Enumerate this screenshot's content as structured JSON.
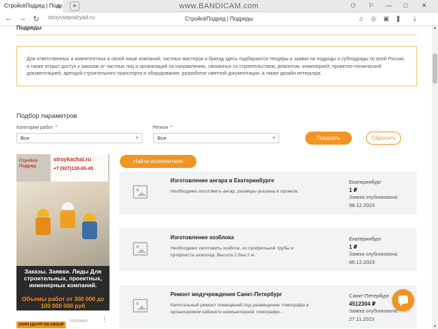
{
  "browser": {
    "tab_title": "СтройсёПодряд | Подр",
    "tab_close": "×",
    "new_tab": "+",
    "watermark": "www.BANDICAM.com",
    "url": "stroyvsepodryad.ru",
    "page_title": "СтройсёПодряд | Подряды"
  },
  "page": {
    "breadcrumb": "Подряды",
    "info_text": "Для ответственных и компетентных в своей нише компаний, частных мастеров и бригад здесь подбираются тендеры и заявки на подряды и субподряды по всей России, а также открыт доступ к заказам от частных лиц и организаций по направлению, связанных со строительством, ремонтом, инженерией, проектно-технической документацией, арендой строительного транспорта и оборудования, разработке сметной документации, а также дизайн интерьера."
  },
  "filters": {
    "title": "Подбор параметров",
    "category_label": "Категории работ",
    "category_value": "Все",
    "region_label": "Регион",
    "region_value": "Все",
    "show_button": "Показать",
    "reset_button": "Сбросить"
  },
  "ad": {
    "logo_text": "Стройсё Подряд",
    "site": "stroykachat.ru",
    "phone": "+7 (927)130-65-45",
    "slogan": "Заказы. Заявки. Лиды Для строительных, проектных, инженерных компаний.",
    "slogan2": "Объемы работ от 300 000 до 100 000 000 руб",
    "footer_tag": "ХОЛЛ ЦЕНТР DS GROUP",
    "footer_label": "РЕКЛАМА",
    "footer_dots": "⋮"
  },
  "find_button": "Найти исполнителя",
  "listings": [
    {
      "title": "Изготовление ангара в Екатеринбурге",
      "desc": "Необходимо изготовить ангар, размеры указаны в проекте.",
      "city": "Екатеринбург",
      "price": "1 ₽",
      "published_label": "Заявка опубликована:",
      "date": "08.12.2023"
    },
    {
      "title": "Изготовление хозблока",
      "desc": "Необходимо изготовить хозблок, из профильной трубы и профлиста шоколад. Высота 2.5на 2 м.",
      "city": "Екатеринбург",
      "price": "1 ₽",
      "published_label": "Заявка опубликована:",
      "date": "06.12.2023"
    },
    {
      "title": "Ремонт медучреждения Санкт-Петербург",
      "desc": "Капитальный ремонт помещений под размещение томографа в организуемом кабинете компьютерной томографи...",
      "city": "Санкт-Петербург",
      "price": "4512304 ₽",
      "published_label": "Заявка опубликована:",
      "date": "27.11.2023"
    }
  ],
  "colors": {
    "accent": "#f39323",
    "card_bg": "#f2f4f4",
    "info_border": "#f2c16e"
  },
  "icons": {
    "back": "←",
    "forward": "→",
    "reload": "↻",
    "menu": "≡",
    "chevron": "⌃"
  }
}
